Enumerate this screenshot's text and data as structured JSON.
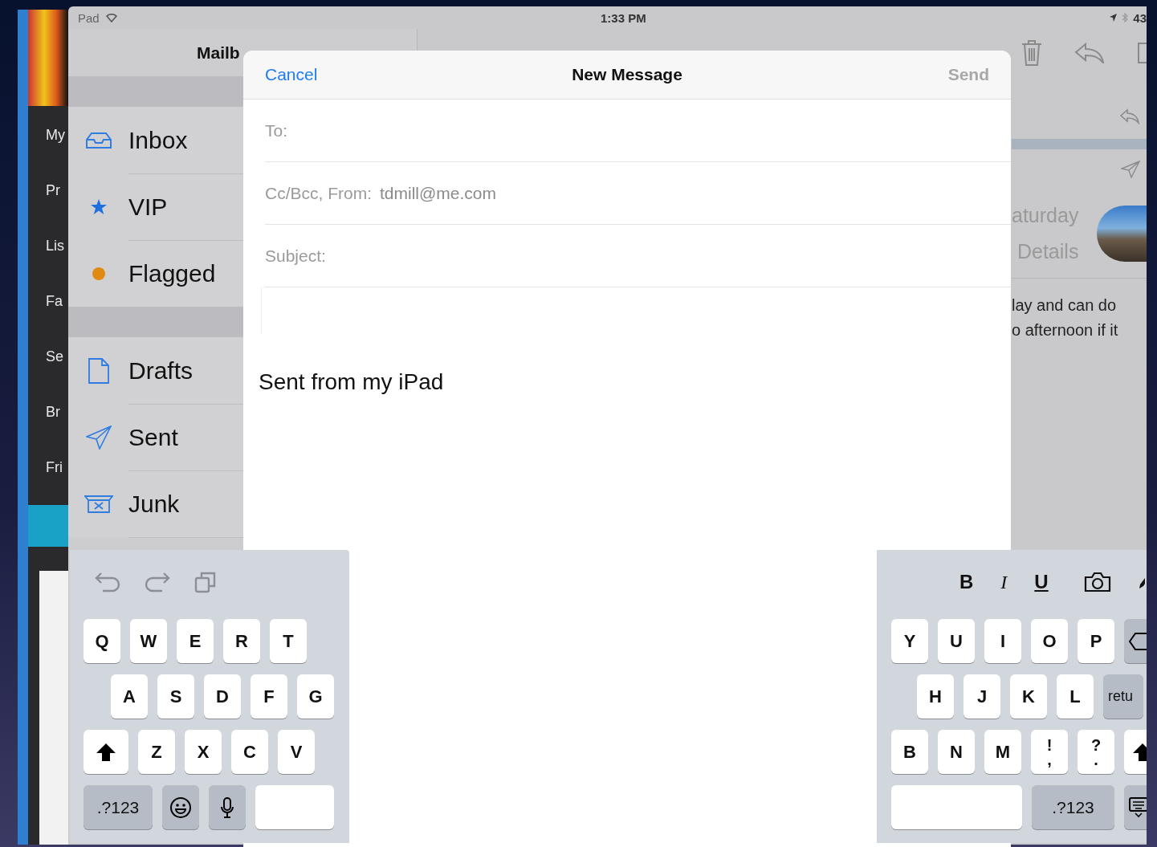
{
  "side_app": {
    "items": [
      "My",
      "Pr",
      "Lis",
      "Fa",
      "Se",
      "Br",
      "Fri"
    ]
  },
  "status_bar": {
    "device": "Pad",
    "time": "1:33 PM",
    "battery": "43"
  },
  "mail": {
    "nav_title": "Mailb",
    "mailbox_groups": [
      {
        "items": [
          {
            "label": "Inbox",
            "kind": "inbox"
          },
          {
            "label": "VIP",
            "kind": "vip"
          },
          {
            "label": "Flagged",
            "kind": "flagged"
          }
        ]
      },
      {
        "items": [
          {
            "label": "Drafts",
            "kind": "drafts"
          },
          {
            "label": "Sent",
            "kind": "sent"
          },
          {
            "label": "Junk",
            "kind": "junk"
          }
        ]
      }
    ],
    "preview": {
      "date": "aturday",
      "details": "Details",
      "snippet": [
        "lay and can do",
        "o afternoon if it"
      ]
    }
  },
  "composer": {
    "cancel": "Cancel",
    "title": "New Message",
    "send": {
      "label": "Send",
      "disabled": true
    },
    "fields": [
      {
        "label": "To:"
      },
      {
        "label": "Cc/Bcc, From:",
        "value": "tdmill@me.com"
      },
      {
        "label": "Subject:"
      }
    ],
    "signature": "Sent from my iPad"
  },
  "keyboard": {
    "left": {
      "rows": [
        [
          {
            "kind": "letter",
            "label": "Q"
          },
          {
            "kind": "letter",
            "label": "W"
          },
          {
            "kind": "letter",
            "label": "E"
          },
          {
            "kind": "letter",
            "label": "R"
          },
          {
            "kind": "letter",
            "label": "T"
          }
        ],
        [
          {
            "kind": "letter",
            "label": "A"
          },
          {
            "kind": "letter",
            "label": "S"
          },
          {
            "kind": "letter",
            "label": "D"
          },
          {
            "kind": "letter",
            "label": "F"
          },
          {
            "kind": "letter",
            "label": "G"
          }
        ],
        [
          {
            "kind": "shift"
          },
          {
            "kind": "letter",
            "label": "Z"
          },
          {
            "kind": "letter",
            "label": "X"
          },
          {
            "kind": "letter",
            "label": "C"
          },
          {
            "kind": "letter",
            "label": "V"
          }
        ],
        [
          {
            "kind": "numbers",
            "label": ".?123"
          },
          {
            "kind": "emoji"
          },
          {
            "kind": "mic"
          },
          {
            "kind": "space"
          }
        ]
      ]
    },
    "right": {
      "rows": [
        [
          {
            "kind": "letter",
            "label": "Y"
          },
          {
            "kind": "letter",
            "label": "U"
          },
          {
            "kind": "letter",
            "label": "I"
          },
          {
            "kind": "letter",
            "label": "O"
          },
          {
            "kind": "letter",
            "label": "P"
          },
          {
            "kind": "delete"
          }
        ],
        [
          {
            "kind": "letter",
            "label": "H"
          },
          {
            "kind": "letter",
            "label": "J"
          },
          {
            "kind": "letter",
            "label": "K"
          },
          {
            "kind": "letter",
            "label": "L"
          },
          {
            "kind": "return",
            "label": "retu"
          }
        ],
        [
          {
            "kind": "letter",
            "label": "B"
          },
          {
            "kind": "letter",
            "label": "N"
          },
          {
            "kind": "letter",
            "label": "M"
          },
          {
            "kind": "dual",
            "top": "!",
            "bottom": ","
          },
          {
            "kind": "dual",
            "top": "?",
            "bottom": "."
          },
          {
            "kind": "shift"
          }
        ],
        [
          {
            "kind": "space"
          },
          {
            "kind": "numbers",
            "label": ".?123"
          },
          {
            "kind": "hide"
          }
        ]
      ]
    },
    "format": {
      "bold": "B",
      "italic": "I",
      "underline": "U"
    }
  }
}
